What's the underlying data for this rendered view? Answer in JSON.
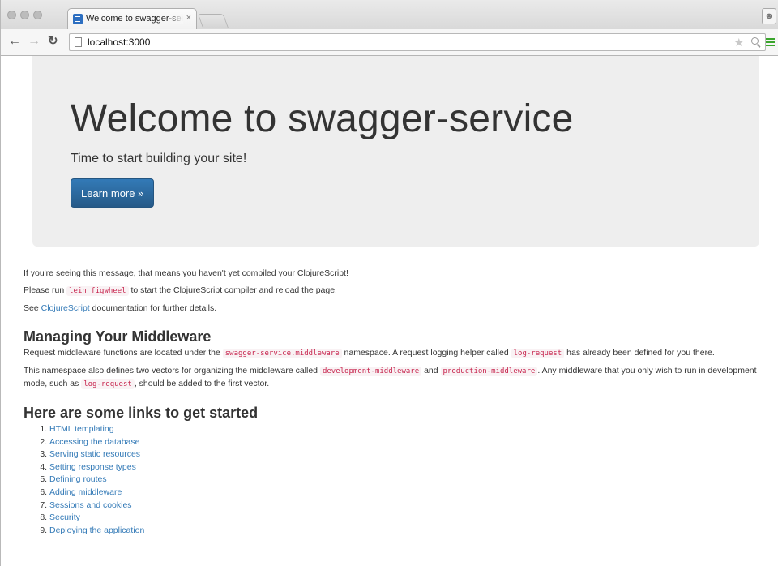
{
  "browser": {
    "tab_title": "Welcome to swagger-service",
    "tab_close": "×",
    "url": "localhost:3000"
  },
  "jumbotron": {
    "title": "Welcome to swagger-service",
    "subtitle": "Time to start building your site!",
    "button_label": "Learn more »"
  },
  "intro": {
    "line1": "If you're seeing this message, that means you haven't yet compiled your ClojureScript!",
    "line2_before": "Please run ",
    "line2_code": "lein figwheel",
    "line2_after": " to start the ClojureScript compiler and reload the page.",
    "line3_before": "See ",
    "line3_link": "ClojureScript",
    "line3_after": " documentation for further details."
  },
  "middleware": {
    "heading": "Managing Your Middleware",
    "p1_a": "Request middleware functions are located under the ",
    "p1_code1": "swagger-service.middleware",
    "p1_b": " namespace. A request logging helper called ",
    "p1_code2": "log-request",
    "p1_c": " has already been defined for you there.",
    "p2_a": "This namespace also defines two vectors for organizing the middleware called ",
    "p2_code1": "development-middleware",
    "p2_b": " and ",
    "p2_code2": "production-middleware",
    "p2_c": ". Any middleware that you only wish to run in development mode, such as ",
    "p2_code3": "log-request",
    "p2_d": ", should be added to the first vector."
  },
  "links": {
    "heading": "Here are some links to get started",
    "items": [
      "HTML templating",
      "Accessing the database",
      "Serving static resources",
      "Setting response types",
      "Defining routes",
      "Adding middleware",
      "Sessions and cookies",
      "Security",
      "Deploying the application"
    ]
  }
}
